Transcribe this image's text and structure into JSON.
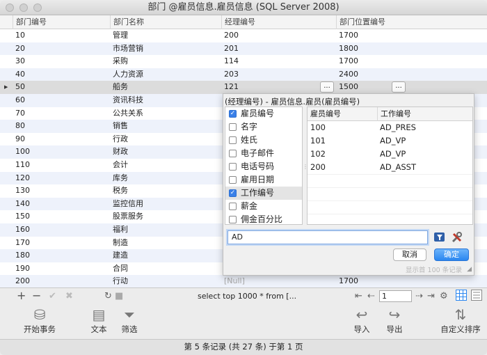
{
  "window": {
    "title": "部门 @雇员信息.雇员信息 (SQL Server 2008)"
  },
  "grid": {
    "columns": [
      "部门编号",
      "部门名称",
      "经理编号",
      "部门位置编号"
    ],
    "rows": [
      [
        "10",
        "管理",
        "200",
        "1700"
      ],
      [
        "20",
        "市场营销",
        "201",
        "1800"
      ],
      [
        "30",
        "采购",
        "114",
        "1700"
      ],
      [
        "40",
        "人力资源",
        "203",
        "2400"
      ],
      [
        "50",
        "船务",
        "121",
        "1500"
      ],
      [
        "60",
        "资讯科技",
        "",
        ""
      ],
      [
        "70",
        "公共关系",
        "",
        ""
      ],
      [
        "80",
        "销售",
        "",
        ""
      ],
      [
        "90",
        "行政",
        "",
        ""
      ],
      [
        "100",
        "财政",
        "",
        ""
      ],
      [
        "110",
        "会计",
        "",
        ""
      ],
      [
        "120",
        "库务",
        "",
        ""
      ],
      [
        "130",
        "税务",
        "",
        ""
      ],
      [
        "140",
        "监控信用",
        "",
        ""
      ],
      [
        "150",
        "股票服务",
        "",
        ""
      ],
      [
        "160",
        "福利",
        "",
        ""
      ],
      [
        "170",
        "制造",
        "",
        ""
      ],
      [
        "180",
        "建造",
        "",
        ""
      ],
      [
        "190",
        "合同",
        "",
        ""
      ],
      [
        "200",
        "行动",
        "[Null]",
        "1700"
      ]
    ],
    "ellipsis": "..."
  },
  "popup": {
    "title": "(经理编号) - 雇员信息.雇员(雇员编号)",
    "columns": [
      {
        "label": "雇员编号",
        "checked": true
      },
      {
        "label": "名字",
        "checked": false
      },
      {
        "label": "姓氏",
        "checked": false
      },
      {
        "label": "电子邮件",
        "checked": false
      },
      {
        "label": "电话号码",
        "checked": false
      },
      {
        "label": "雇用日期",
        "checked": false
      },
      {
        "label": "工作编号",
        "checked": true
      },
      {
        "label": "薪金",
        "checked": false
      },
      {
        "label": "佣金百分比",
        "checked": false
      }
    ],
    "result_headers": [
      "雇员编号",
      "工作编号"
    ],
    "result_rows": [
      [
        "100",
        "AD_PRES"
      ],
      [
        "101",
        "AD_VP"
      ],
      [
        "102",
        "AD_VP"
      ],
      [
        "200",
        "AD_ASST"
      ]
    ],
    "search_value": "AD",
    "cancel_label": "取消",
    "ok_label": "确定",
    "note": "显示首 100 条记录"
  },
  "grid_toolbar": {
    "sql": "select top 1000 * from [...",
    "page": "1"
  },
  "main_toolbar": {
    "begin_tx": "开始事务",
    "text": "文本",
    "filter": "筛选",
    "import": "导入",
    "export": "导出",
    "custom_sort": "自定义排序"
  },
  "status": "第 5 条记录 (共 27 条) 于第 1 页",
  "colors": {
    "accent": "#2a86f0",
    "alt_row": "#eef2fb",
    "selected_row": "#dcdcdc"
  }
}
